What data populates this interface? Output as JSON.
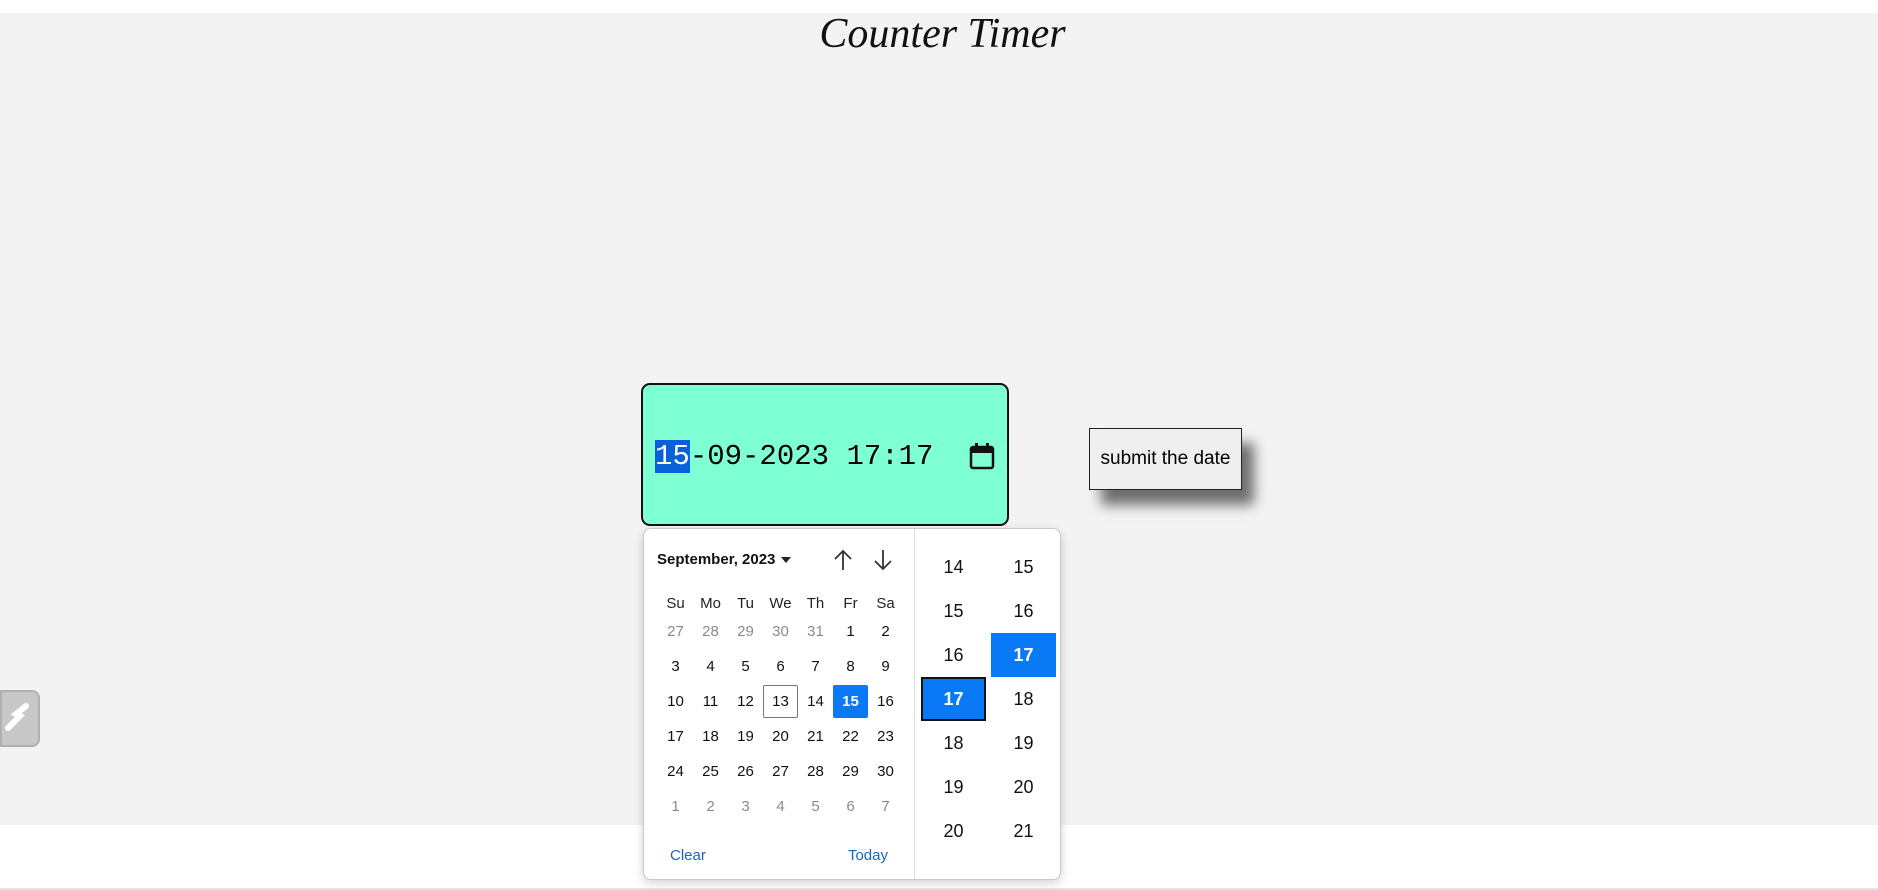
{
  "page": {
    "title": "Counter Timer"
  },
  "datetime_input": {
    "day": "15",
    "rest": "-09-2023 17:17",
    "calendar_icon": "calendar-icon"
  },
  "submit": {
    "label": "submit the date"
  },
  "picker": {
    "month_label": "September, 2023",
    "prev_icon": "arrow-up-icon",
    "next_icon": "arrow-down-icon",
    "weekdays": [
      "Su",
      "Mo",
      "Tu",
      "We",
      "Th",
      "Fr",
      "Sa"
    ],
    "weeks": [
      [
        "27",
        "28",
        "29",
        "30",
        "31",
        "1",
        "2"
      ],
      [
        "3",
        "4",
        "5",
        "6",
        "7",
        "8",
        "9"
      ],
      [
        "10",
        "11",
        "12",
        "13",
        "14",
        "15",
        "16"
      ],
      [
        "17",
        "18",
        "19",
        "20",
        "21",
        "22",
        "23"
      ],
      [
        "24",
        "25",
        "26",
        "27",
        "28",
        "29",
        "30"
      ],
      [
        "1",
        "2",
        "3",
        "4",
        "5",
        "6",
        "7"
      ]
    ],
    "today_day": "13",
    "selected_day": "15",
    "clear_label": "Clear",
    "today_label": "Today",
    "hours": [
      "14",
      "15",
      "16",
      "17",
      "18",
      "19",
      "20"
    ],
    "selected_hour": "17",
    "minutes": [
      "15",
      "16",
      "17",
      "18",
      "19",
      "20",
      "21"
    ],
    "selected_minute": "17"
  },
  "colors": {
    "input_bg": "#7fffd4",
    "accent": "#0a79f5",
    "link": "#1565c0"
  }
}
